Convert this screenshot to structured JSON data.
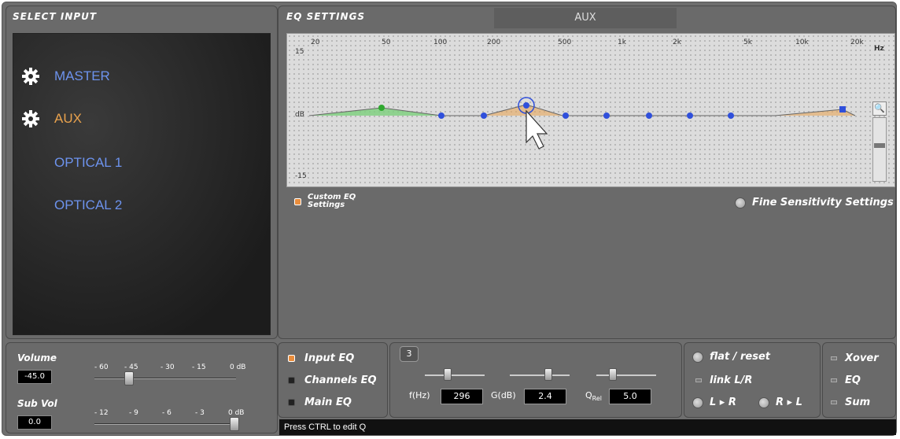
{
  "select_input": {
    "title": "Select Input",
    "items": [
      {
        "label": "MASTER",
        "has_gear": true,
        "active": false
      },
      {
        "label": "AUX",
        "has_gear": true,
        "active": true
      },
      {
        "label": "OPTICAL 1",
        "has_gear": false,
        "active": false
      },
      {
        "label": "OPTICAL 2",
        "has_gear": false,
        "active": false
      }
    ]
  },
  "eq_settings": {
    "title": "EQ Settings",
    "tab_label": "AUX",
    "freq_ticks": [
      "20",
      "50",
      "100",
      "200",
      "500",
      "1k",
      "2k",
      "5k",
      "10k",
      "20k"
    ],
    "unit_hz": "Hz",
    "db_top": "15",
    "db_mid": "dB",
    "db_bottom": "-15",
    "custom_eq_label_line1": "Custom EQ",
    "custom_eq_label_line2": "Settings",
    "fine_sensitivity_label": "Fine Sensitivity Settings",
    "zoom_icon": "magnifier-icon"
  },
  "volume": {
    "volume_label": "Volume",
    "volume_value": "-45.0",
    "volume_scale": [
      "- 60",
      "- 45",
      "- 30",
      "- 15",
      "0 dB"
    ],
    "subvol_label": "Sub Vol",
    "subvol_value": "0.0",
    "subvol_scale": [
      "- 12",
      "- 9",
      "- 6",
      "- 3",
      "0 dB"
    ]
  },
  "eq_select": {
    "options": [
      {
        "label": "Input EQ",
        "on": true
      },
      {
        "label": "Channels EQ",
        "on": false
      },
      {
        "label": "Main EQ",
        "on": false
      }
    ]
  },
  "params": {
    "band": "3",
    "freq_label": "f(Hz)",
    "freq_value": "296",
    "gain_label": "G(dB)",
    "gain_value": "2.4",
    "q_label": "Q",
    "q_sub": "Rel",
    "q_value": "5.0"
  },
  "flat_panel": {
    "flat_reset": "flat / reset",
    "link_lr": "link L/R",
    "l_to_r": "L ▸ R",
    "r_to_l": "R ▸ L"
  },
  "xover_panel": {
    "xover": "Xover",
    "eq": "EQ",
    "sum": "Sum"
  },
  "status": "Press CTRL to edit Q"
}
